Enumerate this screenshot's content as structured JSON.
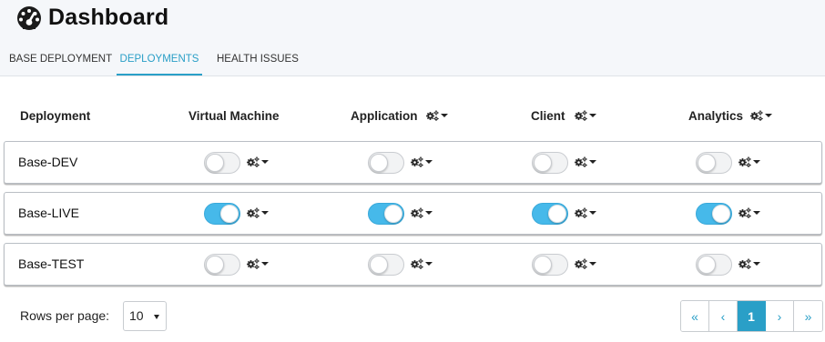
{
  "header": {
    "title": "Dashboard",
    "icon": "tachometer-icon"
  },
  "tabs": [
    {
      "label": "BASE DEPLOYMENT",
      "active": false
    },
    {
      "label": "DEPLOYMENTS",
      "active": true
    },
    {
      "label": "HEALTH ISSUES",
      "active": false
    }
  ],
  "table": {
    "columns": [
      {
        "label": "Deployment",
        "has_menu": false
      },
      {
        "label": "Virtual Machine",
        "has_menu": false
      },
      {
        "label": "Application",
        "has_menu": true
      },
      {
        "label": "Client",
        "has_menu": true
      },
      {
        "label": "Analytics",
        "has_menu": true
      }
    ],
    "rows": [
      {
        "name": "Base-DEV",
        "toggles": {
          "virtual_machine": false,
          "application": false,
          "client": false,
          "analytics": false
        }
      },
      {
        "name": "Base-LIVE",
        "toggles": {
          "virtual_machine": true,
          "application": true,
          "client": true,
          "analytics": true
        }
      },
      {
        "name": "Base-TEST",
        "toggles": {
          "virtual_machine": false,
          "application": false,
          "client": false,
          "analytics": false
        }
      }
    ]
  },
  "footer": {
    "rows_per_page_label": "Rows per page:",
    "rows_per_page_value": "10",
    "pagination": {
      "first": "«",
      "prev": "‹",
      "current_page": "1",
      "next": "›",
      "last": "»"
    }
  },
  "colors": {
    "accent": "#2a9fc7",
    "toggle_on": "#46b9ea",
    "header_bg": "#f5f7fa"
  }
}
